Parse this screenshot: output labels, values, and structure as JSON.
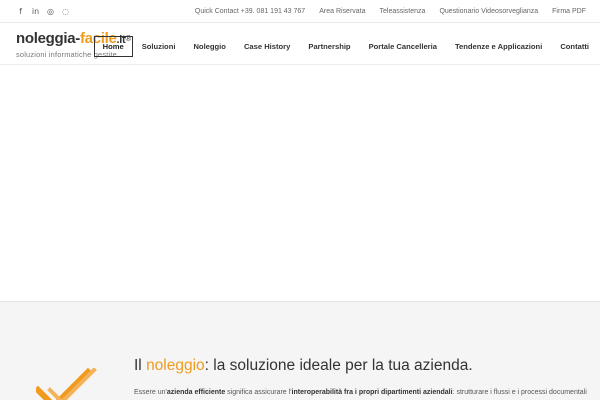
{
  "topbar": {
    "social": [
      {
        "icon": "facebook-icon",
        "glyph": "f"
      },
      {
        "icon": "linkedin-icon",
        "glyph": "in"
      },
      {
        "icon": "instagram-icon",
        "glyph": "◎"
      },
      {
        "icon": "whatsapp-icon",
        "glyph": "◌"
      }
    ],
    "links": [
      "Quick Contact +39. 081 191 43 767",
      "Area Riservata",
      "Teleassistenza",
      "Questionario Videosorveglianza",
      "Firma PDF"
    ]
  },
  "logo": {
    "part1": "noleggia-",
    "part2": "facile",
    "part3": ".it",
    "reg": "®",
    "tagline": "soluzioni informatiche gestite"
  },
  "nav": {
    "items": [
      "Home",
      "Soluzioni",
      "Noleggio",
      "Case History",
      "Partnership",
      "Portale Cancelleria",
      "Tendenze e Applicazioni",
      "Contatti"
    ],
    "active": "Home"
  },
  "section": {
    "headline_pre": "Il ",
    "headline_accent": "noleggio",
    "headline_post": ": la soluzione ideale per la tua azienda.",
    "body_1": "Essere un'",
    "body_2": "azienda efficiente",
    "body_3": " significa assicurare l'",
    "body_4": "interoperabilità fra i propri dipartimenti aziendali",
    "body_5": ": strutturare i flussi e i processi documentali"
  },
  "colors": {
    "accent": "#f09b1e",
    "section_bg": "#f5f5f6"
  }
}
